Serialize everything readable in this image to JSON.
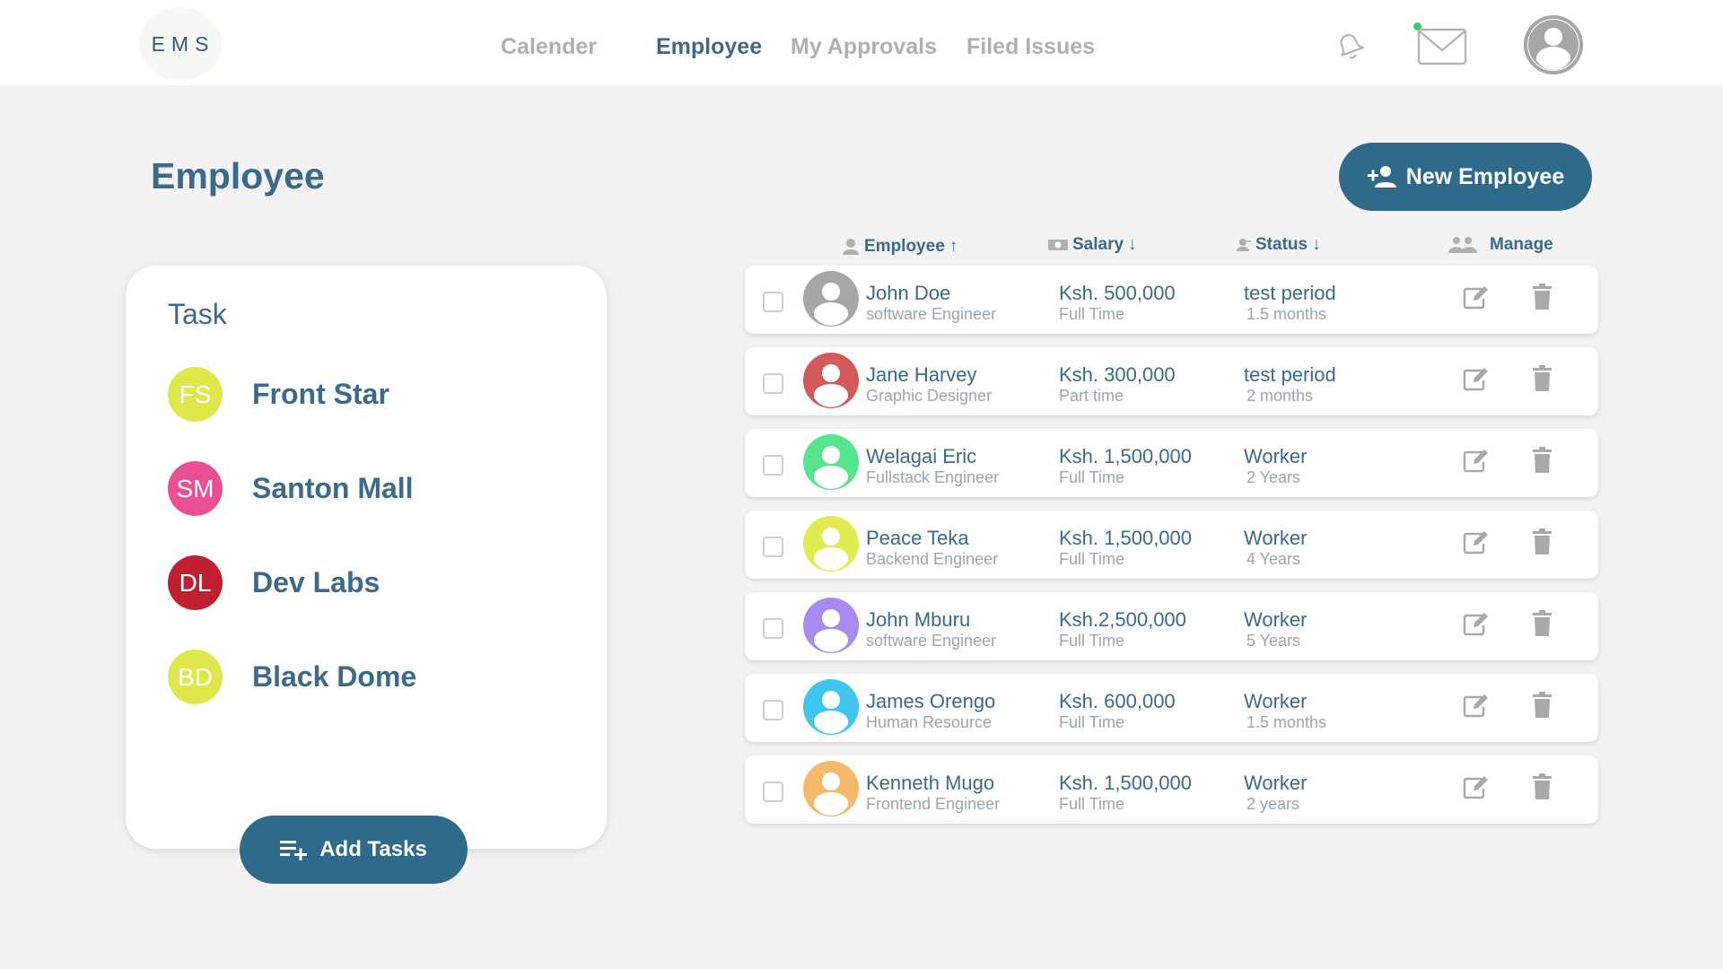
{
  "header": {
    "logo": "EMS",
    "nav": [
      {
        "label": "Calender",
        "active": false
      },
      {
        "label": "Employee",
        "active": true
      },
      {
        "label": "My Approvals",
        "active": false
      },
      {
        "label": "Filed Issues",
        "active": false
      }
    ],
    "icons": [
      "bell-icon",
      "mail-icon",
      "user-avatar-icon"
    ],
    "notification_dot_color": "#36d36a"
  },
  "page_title": "Employee",
  "new_employee_button": "New Employee",
  "task_panel": {
    "title": "Task",
    "items": [
      {
        "initials": "FS",
        "name": "Front Star",
        "color": "#dfe84a"
      },
      {
        "initials": "SM",
        "name": "Santon Mall",
        "color": "#ea4f94"
      },
      {
        "initials": "DL",
        "name": "Dev Labs",
        "color": "#c01f2e"
      },
      {
        "initials": "BD",
        "name": "Black Dome",
        "color": "#dfe84a"
      }
    ],
    "add_button": "Add Tasks"
  },
  "table": {
    "columns": [
      "Employee",
      "Salary",
      "Status",
      "Manage"
    ],
    "sort_glyphs": [
      "↑",
      "↓",
      "↓"
    ],
    "rows": [
      {
        "name": "John Doe",
        "role": "software Engineer",
        "salary": "Ksh. 500,000",
        "type": "Full Time",
        "status": "test period",
        "duration": "1.5 months",
        "avatar_color": "#a7a7a7"
      },
      {
        "name": "Jane Harvey",
        "role": "Graphic Designer",
        "salary": "Ksh. 300,000",
        "type": "Part time",
        "status": "test period",
        "duration": "2 months",
        "avatar_color": "#d35a5a"
      },
      {
        "name": "Welagai Eric",
        "role": "Fullstack Engineer",
        "salary": "Ksh. 1,500,000",
        "type": "Full Time",
        "status": "Worker",
        "duration": "2 Years",
        "avatar_color": "#55e58f"
      },
      {
        "name": "Peace Teka",
        "role": "Backend Engineer",
        "salary": "Ksh. 1,500,000",
        "type": "Full Time",
        "status": "Worker",
        "duration": "4 Years",
        "avatar_color": "#dfee4e"
      },
      {
        "name": "John Mburu",
        "role": "software Engineer",
        "salary": "Ksh.2,500,000",
        "type": "Full Time",
        "status": "Worker",
        "duration": "5 Years",
        "avatar_color": "#a98af2"
      },
      {
        "name": "James Orengo",
        "role": "Human Resource",
        "salary": "Ksh. 600,000",
        "type": "Full Time",
        "status": "Worker",
        "duration": "1.5 months",
        "avatar_color": "#3ec6ee"
      },
      {
        "name": "Kenneth Mugo",
        "role": "Frontend Engineer",
        "salary": "Ksh. 1,500,000",
        "type": "Full Time",
        "status": "Worker",
        "duration": "2 years",
        "avatar_color": "#f5b96a"
      }
    ]
  }
}
